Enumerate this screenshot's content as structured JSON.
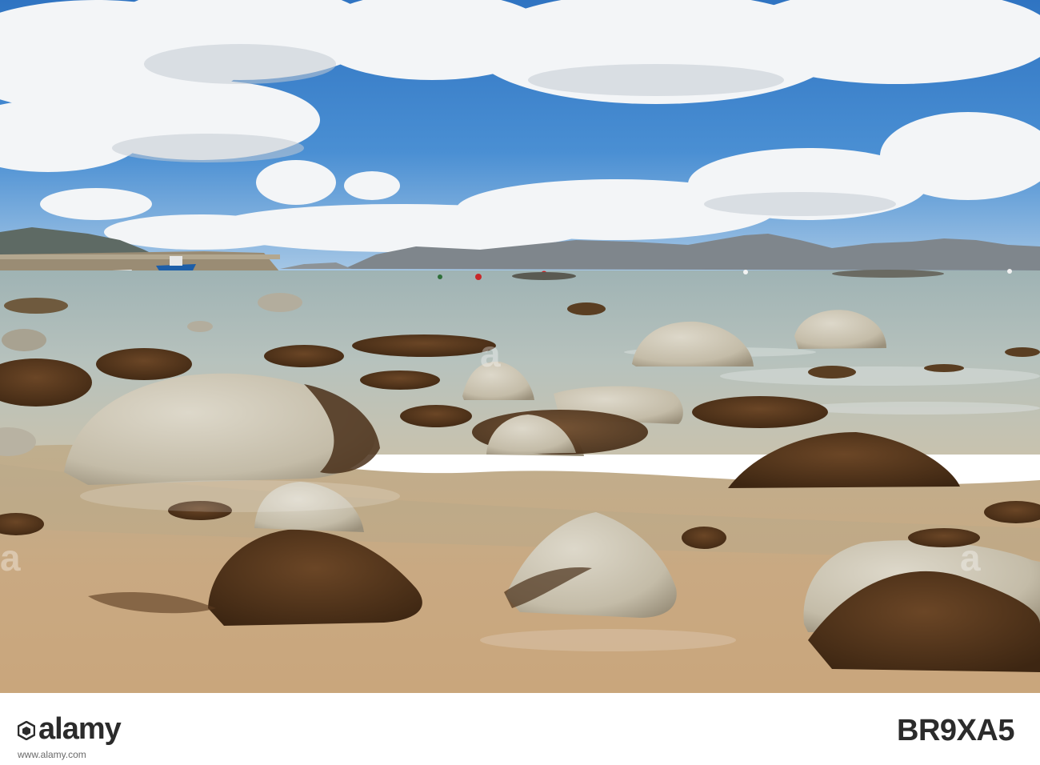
{
  "scene": {
    "subject": "rocky seaweed-covered beach at low tide with harbour, bay and mountains",
    "colors": {
      "sky_top": "#3a7fc8",
      "sky_low": "#9fc4e6",
      "cloud": "#f4f6f8",
      "cloud_shadow": "#b9c2cc",
      "mountain": "#7d858e",
      "sea": "#a9b8b2",
      "sand": "#c9ad88",
      "rock": "#cfc9b8",
      "seaweed": "#5a3a1f"
    }
  },
  "watermark": {
    "logo_text": "alamy",
    "image_id": "BR9XA5",
    "url": "www.alamy.com"
  }
}
